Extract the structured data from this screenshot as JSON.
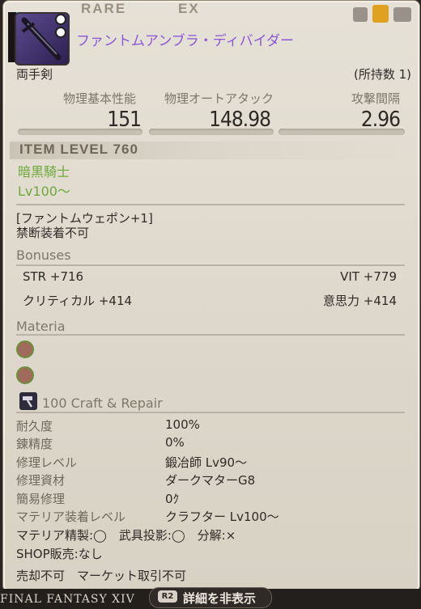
{
  "header": {
    "tag_rare": "RARE",
    "tag_ex": "EX",
    "item_name": "ファントムアンブラ・ディバイダー",
    "item_type": "両手剣",
    "owned_count": "(所持数 1)"
  },
  "stats": {
    "phys_base_label": "物理基本性能",
    "phys_base_value": "151",
    "auto_attack_label": "物理オートアタック",
    "auto_attack_value": "148.98",
    "delay_label": "攻撃間隔",
    "delay_value": "2.96"
  },
  "item_level": "ITEM LEVEL 760",
  "job": "暗黒騎士",
  "level_req": "Lv100〜",
  "series": "[ファントムウェポン+1]",
  "restriction": "禁断装着不可",
  "bonuses": {
    "title": "Bonuses",
    "str": "STR +716",
    "vit": "VIT +779",
    "crit": "クリティカル +414",
    "det": "意思力 +414"
  },
  "materia": {
    "title": "Materia"
  },
  "craft": {
    "title": "100 Craft & Repair",
    "rows": [
      {
        "label": "耐久度",
        "value": "100%"
      },
      {
        "label": "錬精度",
        "value": "0%"
      },
      {
        "label": "修理レベル",
        "value": "鍛冶師 Lv90〜"
      },
      {
        "label": "修理資材",
        "value": "ダークマターG8"
      },
      {
        "label": "簡易修理",
        "value": "0ｸ"
      },
      {
        "label": "マテリア装着レベル",
        "value": "クラフター Lv100〜"
      }
    ],
    "flags": "マテリア精製:◯　武具投影:◯　分解:×",
    "shop": "SHOP販売:なし",
    "trade": "売却不可　マーケット取引不可"
  },
  "footer": {
    "game_logo": "FINAL FANTASY XIV",
    "button_key": "R2",
    "button_label": "詳細を非表示"
  }
}
